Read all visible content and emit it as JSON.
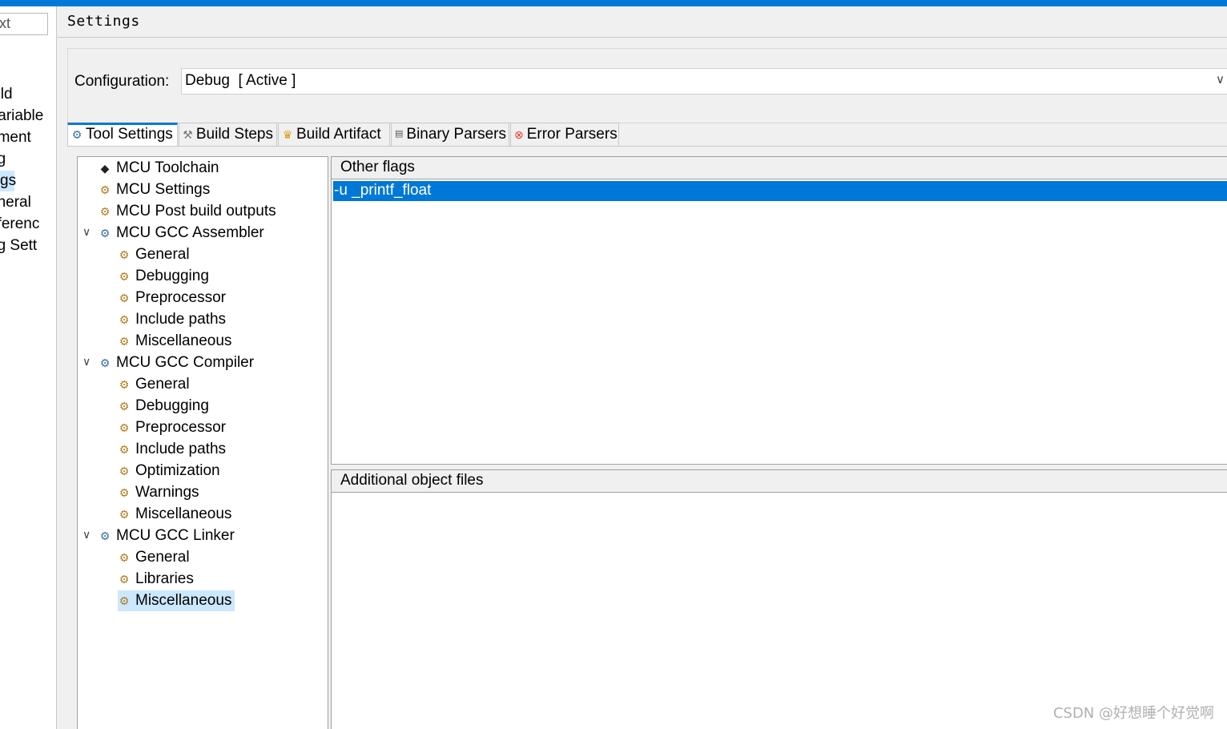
{
  "left_panel": {
    "filter_text": "ext",
    "items": [
      "uild",
      "Variable",
      "nment",
      "ng",
      "gs",
      "eneral",
      "eferenc",
      "ug Sett"
    ],
    "selected_index": 4
  },
  "settings": {
    "title": "Settings"
  },
  "configuration": {
    "label": "Configuration:",
    "value": "Debug  [ Active ]"
  },
  "tabs": [
    {
      "label": "Tool Settings",
      "icon": "gear-icon"
    },
    {
      "label": "Build Steps",
      "icon": "wrench-icon"
    },
    {
      "label": "Build Artifact",
      "icon": "trophy-icon"
    },
    {
      "label": "Binary Parsers",
      "icon": "binary-icon"
    },
    {
      "label": "Error Parsers",
      "icon": "error-icon"
    }
  ],
  "tree": {
    "items": [
      {
        "label": "MCU Toolchain",
        "icon": "chip-icon"
      },
      {
        "label": "MCU Settings",
        "icon": "settings-folder-icon"
      },
      {
        "label": "MCU Post build outputs",
        "icon": "settings-folder-icon"
      },
      {
        "label": "MCU GCC Assembler",
        "icon": "tool-gear-icon",
        "expanded": true
      },
      {
        "label": "General",
        "icon": "settings-folder-icon"
      },
      {
        "label": "Debugging",
        "icon": "settings-folder-icon"
      },
      {
        "label": "Preprocessor",
        "icon": "settings-folder-icon"
      },
      {
        "label": "Include paths",
        "icon": "settings-folder-icon"
      },
      {
        "label": "Miscellaneous",
        "icon": "settings-folder-icon"
      },
      {
        "label": "MCU GCC Compiler",
        "icon": "tool-gear-icon",
        "expanded": true
      },
      {
        "label": "General",
        "icon": "settings-folder-icon"
      },
      {
        "label": "Debugging",
        "icon": "settings-folder-icon"
      },
      {
        "label": "Preprocessor",
        "icon": "settings-folder-icon"
      },
      {
        "label": "Include paths",
        "icon": "settings-folder-icon"
      },
      {
        "label": "Optimization",
        "icon": "settings-folder-icon"
      },
      {
        "label": "Warnings",
        "icon": "settings-folder-icon"
      },
      {
        "label": "Miscellaneous",
        "icon": "settings-folder-icon"
      },
      {
        "label": "MCU GCC Linker",
        "icon": "tool-gear-icon",
        "expanded": true
      },
      {
        "label": "General",
        "icon": "settings-folder-icon"
      },
      {
        "label": "Libraries",
        "icon": "settings-folder-icon"
      },
      {
        "label": "Miscellaneous",
        "icon": "settings-folder-icon",
        "selected": true
      }
    ]
  },
  "other_flags": {
    "header": "Other flags",
    "values": [
      "-u _printf_float"
    ]
  },
  "additional_objects": {
    "header": "Additional object files"
  },
  "watermark": "CSDN @好想睡个好觉啊",
  "colors": {
    "accent": "#0078d7",
    "selection": "#cce8ff"
  }
}
